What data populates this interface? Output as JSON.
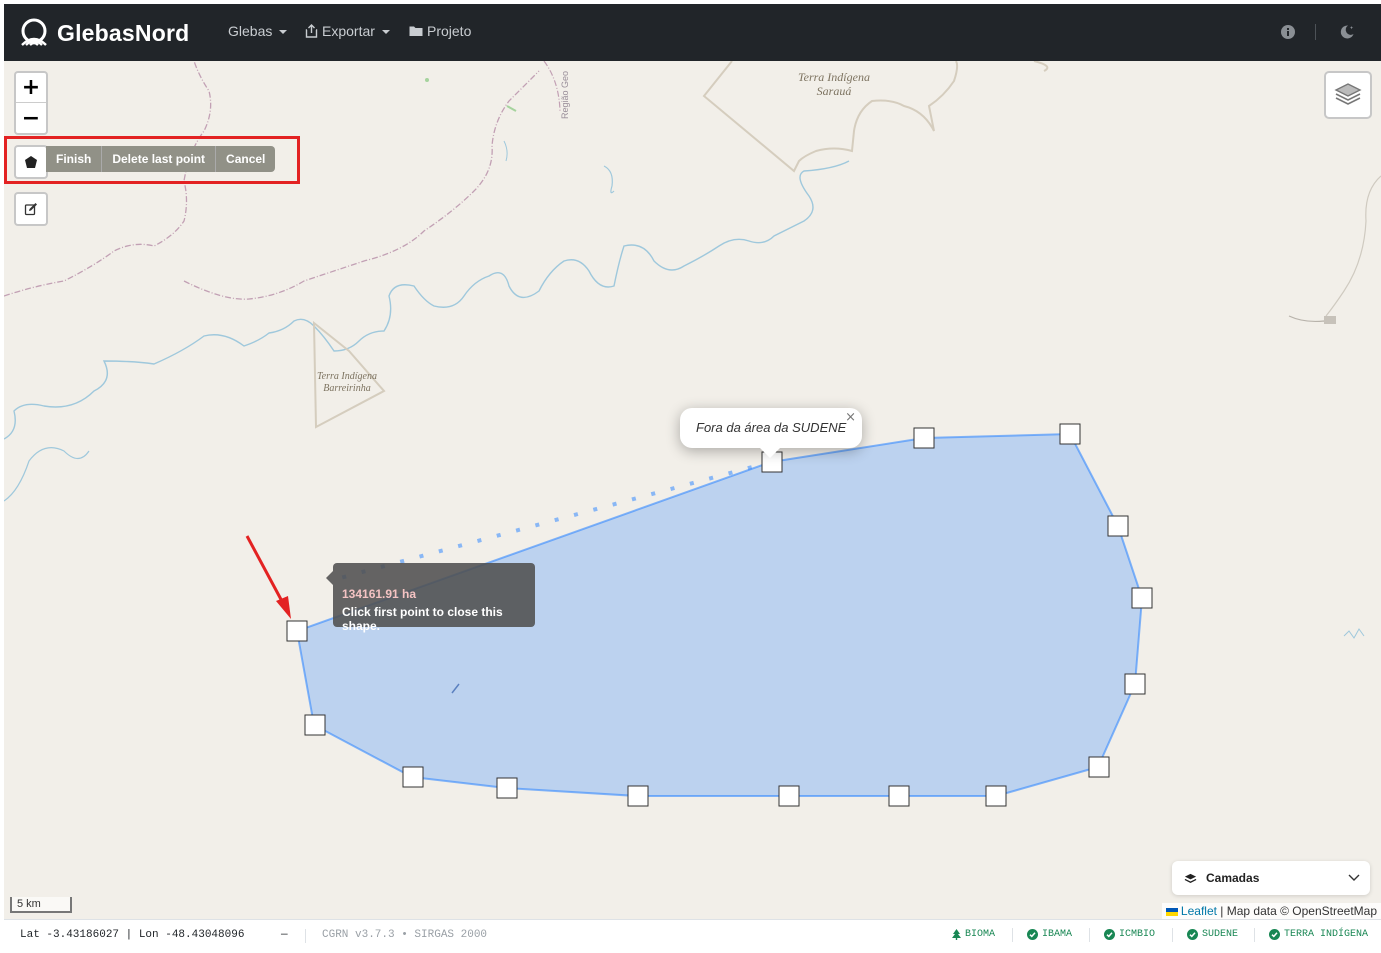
{
  "navbar": {
    "brand": "GlebasNord",
    "menu": [
      {
        "label": "Glebas",
        "icon": "",
        "has_dropdown": true
      },
      {
        "label": "Exportar",
        "icon": "export-icon",
        "has_dropdown": true
      },
      {
        "label": "Projeto",
        "icon": "folder-icon",
        "has_dropdown": false
      }
    ],
    "right_icons": [
      "info-icon",
      "theme-toggle-icon"
    ]
  },
  "map": {
    "labels": {
      "sarau_1": "Terra Indígena",
      "sarau_2": "Sarauá",
      "barreirinha_1": "Terra Indígena",
      "barreirinha_2": "Barreirinha",
      "regiao": "Região Geo"
    },
    "draw_actions": {
      "finish": "Finish",
      "delete_last": "Delete last point",
      "cancel": "Cancel"
    },
    "popup": {
      "text": "Fora da área da SUDENE",
      "close": "×"
    },
    "tooltip": {
      "area": "134161.91 ha",
      "hint": "Click first point to close this shape."
    },
    "camadas_label": "Camadas",
    "scale_label": "5 km",
    "attribution": {
      "leaflet": "Leaflet",
      "rest": " | Map data © OpenStreetMap"
    },
    "polygon_color": "#3388ff"
  },
  "statusbar": {
    "coords": "Lat -3.43186027 | Lon -48.43048096",
    "dash": "—",
    "version": "CGRN v3.7.3 • SIRGAS 2000",
    "badges": [
      {
        "label": "BIOMA",
        "icon": "tree-icon"
      },
      {
        "label": "IBAMA",
        "icon": "check-circle-icon"
      },
      {
        "label": "ICMBIO",
        "icon": "check-circle-icon"
      },
      {
        "label": "SUDENE",
        "icon": "check-circle-icon"
      },
      {
        "label": "TERRA INDÍGENA",
        "icon": "check-circle-icon"
      }
    ],
    "status_color": "#198754"
  }
}
